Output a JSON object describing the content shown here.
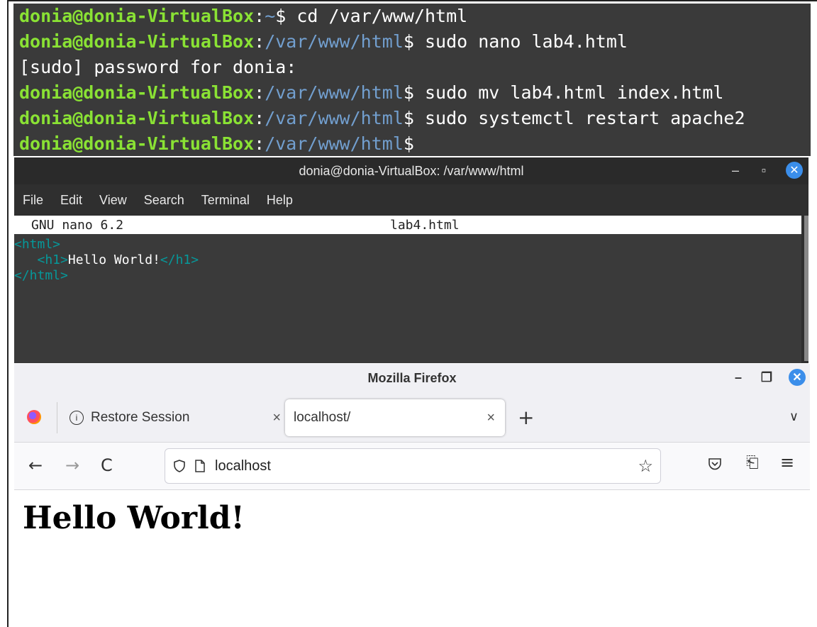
{
  "terminal_log": {
    "prompt_user": "donia@donia-VirtualBox",
    "lines": [
      {
        "path": "~",
        "cmd": " cd /var/www/html"
      },
      {
        "path": "/var/www/html",
        "cmd": " sudo nano lab4.html"
      },
      {
        "path": "/var/www/html",
        "cmd": " sudo mv lab4.html index.html"
      },
      {
        "path": "/var/www/html",
        "cmd": " sudo systemctl restart apache2"
      },
      {
        "path": "/var/www/html",
        "cmd": ""
      }
    ],
    "sudo_prompt": "[sudo] password for donia:"
  },
  "nano_window": {
    "title": "donia@donia-VirtualBox: /var/www/html",
    "menu": [
      "File",
      "Edit",
      "View",
      "Search",
      "Terminal",
      "Help"
    ],
    "version": "GNU nano 6.2",
    "filename": "lab4.html",
    "code": [
      {
        "open": "<html>",
        "text": "",
        "close": ""
      },
      {
        "open": "   <h1>",
        "text": "Hello World!",
        "close": "</h1>"
      },
      {
        "open": "</html>",
        "text": "",
        "close": ""
      }
    ]
  },
  "firefox": {
    "title": "Mozilla Firefox",
    "tabs": [
      {
        "label": "Restore Session",
        "active": false
      },
      {
        "label": "localhost/",
        "active": true
      }
    ],
    "url": "localhost",
    "page_heading": "Hello World!"
  },
  "colors": {
    "prompt_user": "#8ae234",
    "prompt_path": "#729fcf",
    "nano_tag": "#06989a",
    "close_button": "#3b8eea"
  }
}
